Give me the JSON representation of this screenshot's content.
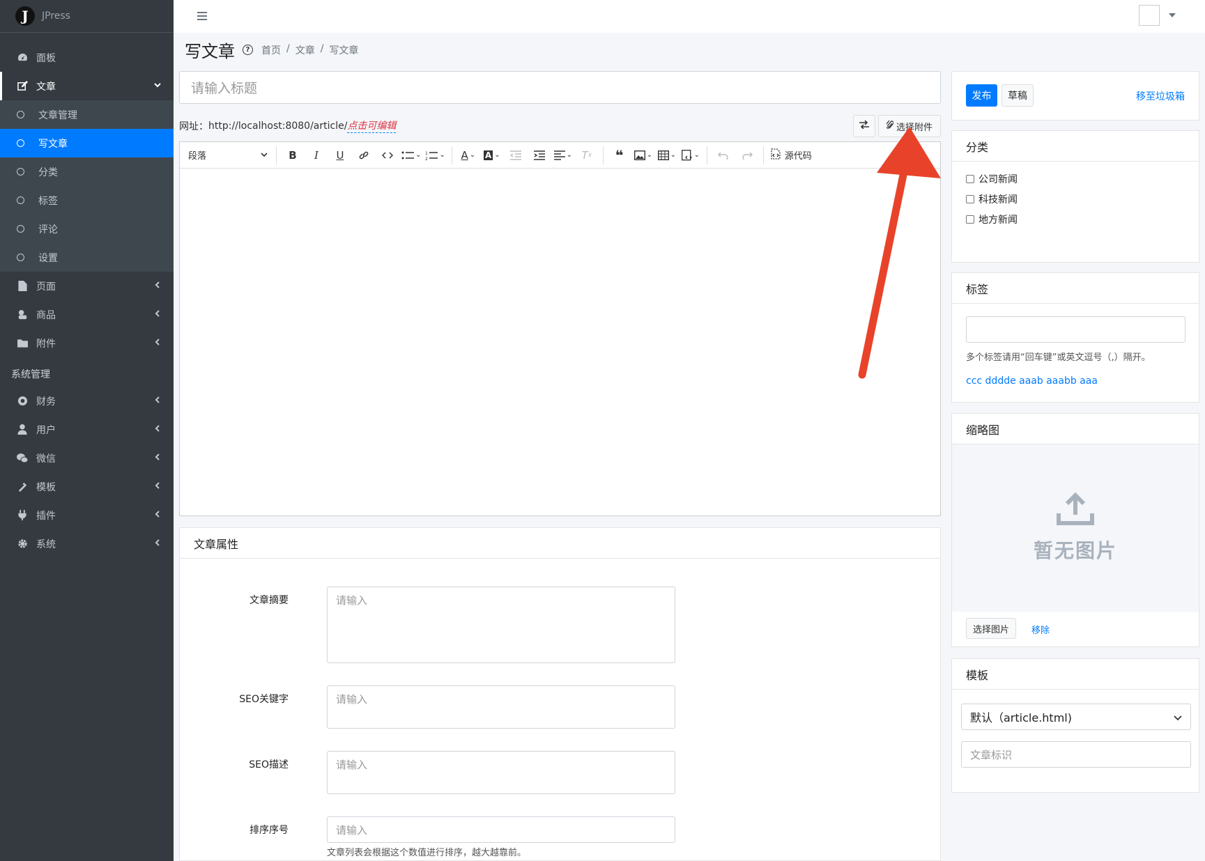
{
  "brand": {
    "logo_letter": "J",
    "name": "JPress"
  },
  "sidebar": {
    "items": [
      {
        "label": "面板",
        "icon": "dashboard-icon"
      },
      {
        "label": "文章",
        "icon": "edit-icon"
      }
    ],
    "sub_items": [
      {
        "label": "文章管理"
      },
      {
        "label": "写文章"
      },
      {
        "label": "分类"
      },
      {
        "label": "标签"
      },
      {
        "label": "评论"
      },
      {
        "label": "设置"
      }
    ],
    "items2": [
      {
        "label": "页面",
        "icon": "file-icon"
      },
      {
        "label": "商品",
        "icon": "shop-icon"
      },
      {
        "label": "附件",
        "icon": "folder-icon"
      }
    ],
    "system_header": "系统管理",
    "system_items": [
      {
        "label": "财务",
        "icon": "finance-icon"
      },
      {
        "label": "用户",
        "icon": "user-icon"
      },
      {
        "label": "微信",
        "icon": "wechat-icon"
      },
      {
        "label": "模板",
        "icon": "brush-icon"
      },
      {
        "label": "插件",
        "icon": "plug-icon"
      },
      {
        "label": "系统",
        "icon": "gear-icon"
      }
    ]
  },
  "header": {
    "title": "写文章",
    "breadcrumb": [
      "首页",
      "/",
      "文章",
      "/",
      "写文章"
    ]
  },
  "editor": {
    "title_placeholder": "请输入标题",
    "url_label": "网址：",
    "url_base": "http://localhost:8080/article/",
    "url_edit": "点击可编辑",
    "attach_label": "选择附件",
    "paragraph": "段落",
    "source_label": "源代码"
  },
  "props": {
    "title": "文章属性",
    "summary_label": "文章摘要",
    "summary_placeholder": "请输入",
    "seo_keywords_label": "SEO关键字",
    "seo_keywords_placeholder": "请输入",
    "seo_desc_label": "SEO描述",
    "seo_desc_placeholder": "请输入",
    "order_label": "排序序号",
    "order_placeholder": "请输入",
    "order_hint": "文章列表会根据这个数值进行排序，越大越靠前。"
  },
  "publish": {
    "publish_label": "发布",
    "draft_label": "草稿",
    "trash_label": "移至垃圾箱"
  },
  "category": {
    "title": "分类",
    "options": [
      "公司新闻",
      "科技新闻",
      "地方新闻"
    ]
  },
  "tags": {
    "title": "标签",
    "hint": "多个标签请用“回车键”或英文逗号（,）隔开。",
    "suggested": "ccc dddde aaab aaabb aaa"
  },
  "thumbnail": {
    "title": "缩略图",
    "empty_text": "暂无图片",
    "select_label": "选择图片",
    "remove_label": "移除"
  },
  "template": {
    "title": "模板",
    "selected": "默认（article.html)",
    "flag_placeholder": "文章标识"
  },
  "colors": {
    "primary": "#007bff",
    "sidebar": "#343a40",
    "annotation_arrow": "#e8432a"
  }
}
